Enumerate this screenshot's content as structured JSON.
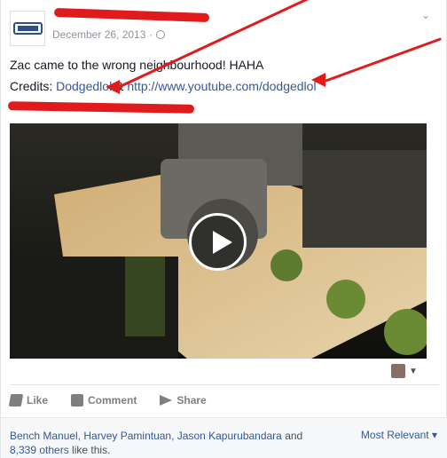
{
  "post": {
    "date": "December 26, 2013",
    "separator": "·",
    "line1": "Zac came to the wrong neighbourhood! HAHA",
    "credits_label": "Credits:",
    "credits_link1": "Dodgedlol",
    "credits_amp": " & ",
    "credits_link2": "http://www.youtube.com/dodgedlol"
  },
  "video": {
    "play_label": "Play",
    "overlay": ""
  },
  "actions": {
    "like": "Like",
    "comment": "Comment",
    "share": "Share"
  },
  "footer": {
    "likers": "Bench Manuel, Harvey Pamintuan, Jason Kapurubandara",
    "and": " and ",
    "others": "8,339 others",
    "tail": " like this.",
    "sort": "Most Relevant"
  },
  "icons": {
    "chev": "chevron-down-icon",
    "globe": "globe-icon",
    "like": "thumbs-up-icon",
    "comment": "comment-icon",
    "share": "share-icon"
  },
  "colors": {
    "link": "#365899",
    "redaction": "#e11b1b"
  }
}
